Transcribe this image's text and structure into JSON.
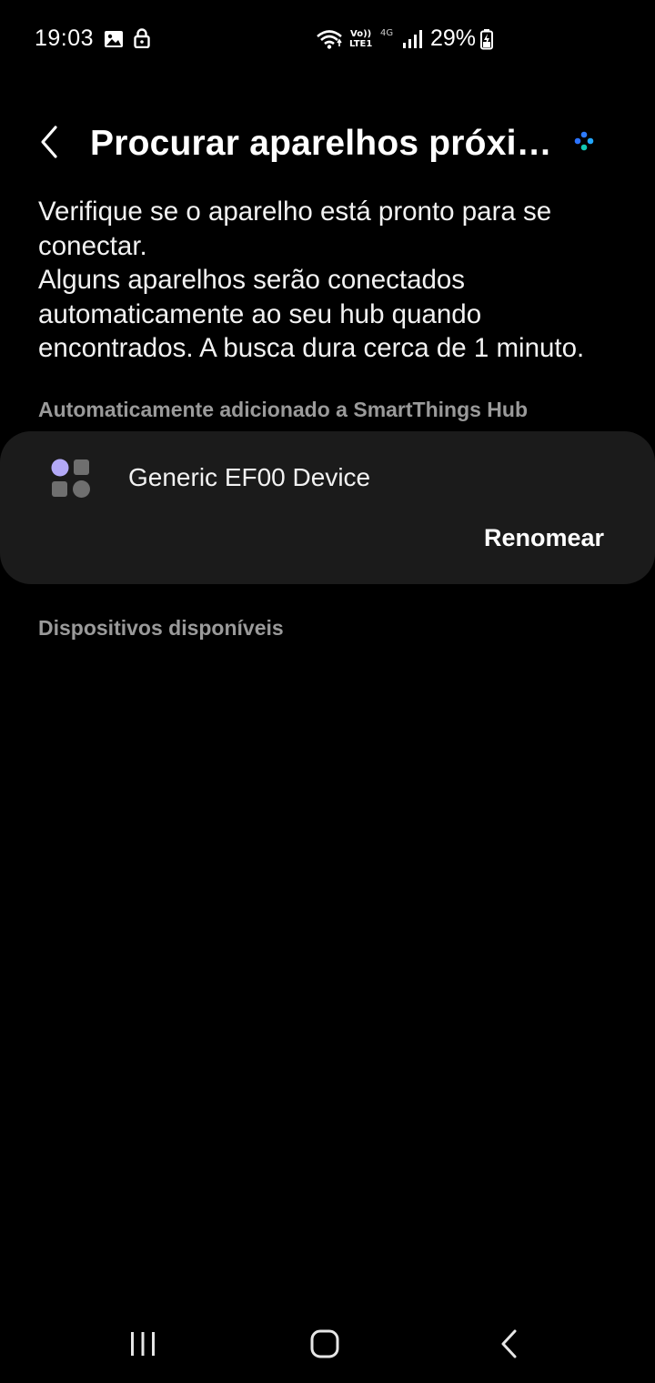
{
  "status_bar": {
    "time": "19:03",
    "battery": "29%",
    "network_vo": "Vo))",
    "network_lte": "LTE1",
    "network_4g": "4G",
    "icons": [
      "gallery-icon",
      "lock-icon",
      "wifi-icon",
      "signal-icon",
      "battery-charging-icon"
    ]
  },
  "header": {
    "title": "Procurar aparelhos próxi…",
    "back_icon": "chevron-left-icon",
    "more_icon": "dots-icon"
  },
  "description": {
    "line1": "Verifique se o aparelho está pronto para se conectar.",
    "line2": "Alguns aparelhos serão conectados automaticamente ao seu hub quando encontrados. A busca dura cerca de 1 minuto."
  },
  "sections": {
    "auto_added": "Automaticamente adicionado a SmartThings Hub",
    "available": "Dispositivos disponíveis"
  },
  "device": {
    "name": "Generic EF00 Device",
    "rename_label": "Renomear",
    "icon": "device-category-icon"
  },
  "nav_bar": {
    "icons": [
      "recent-apps-icon",
      "home-icon",
      "back-icon"
    ]
  },
  "colors": {
    "background": "#000000",
    "card": "#1b1b1b",
    "secondary_text": "#9a9a9a",
    "accent_purple": "#b3a9f7"
  }
}
